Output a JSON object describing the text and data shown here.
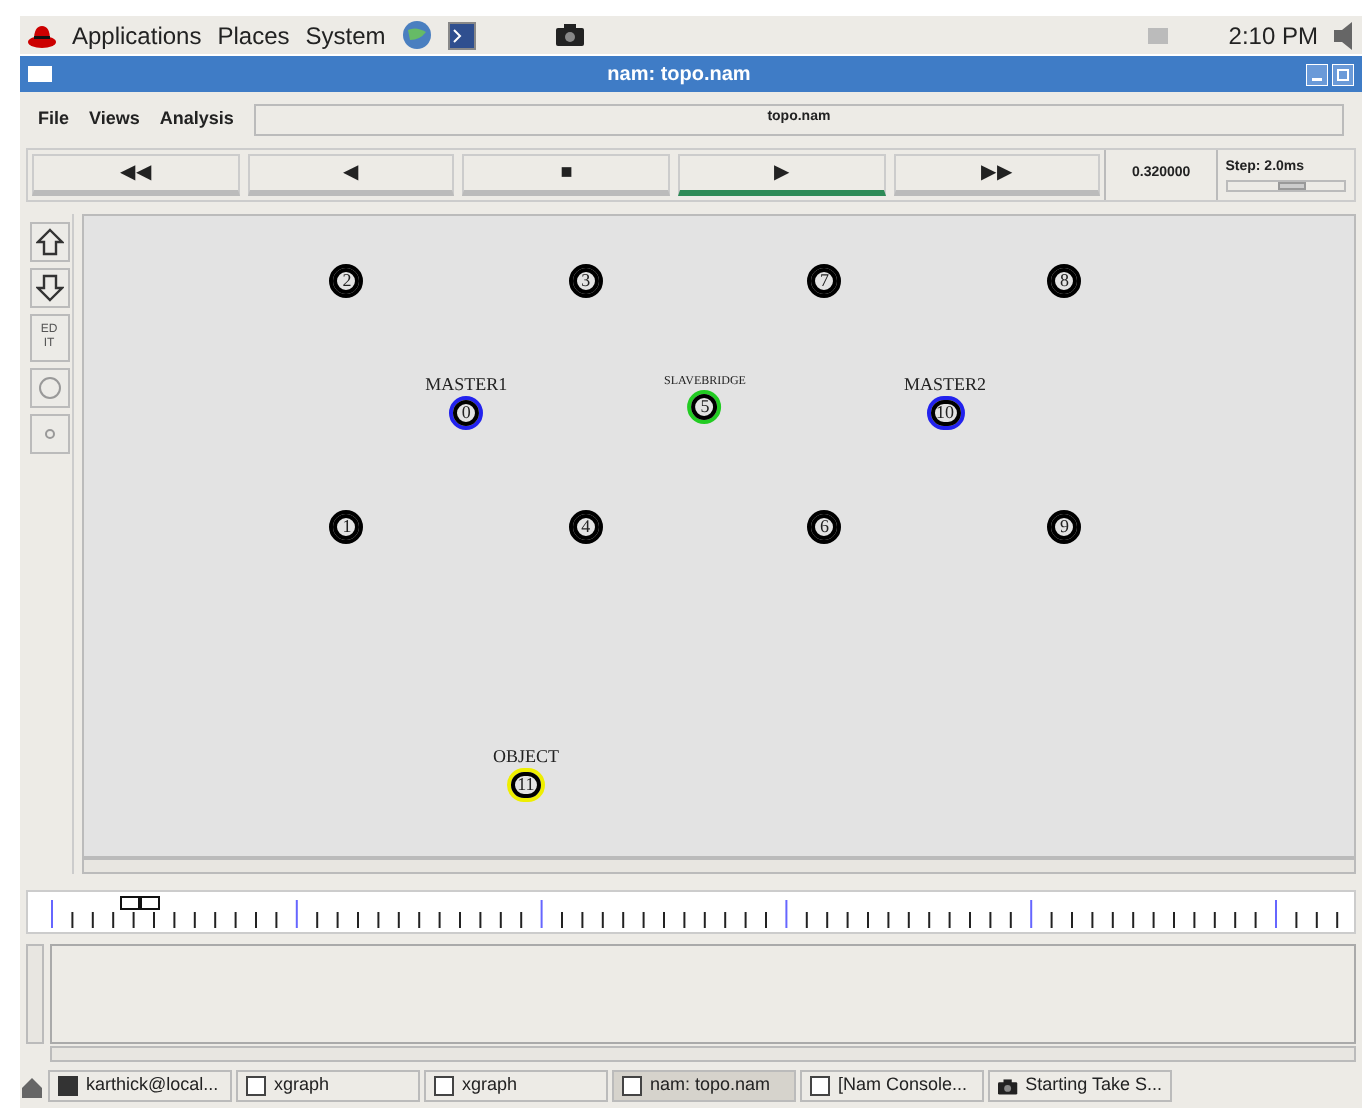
{
  "top_panel": {
    "menus": [
      "Applications",
      "Places",
      "System"
    ],
    "clock": "2:10 PM"
  },
  "window": {
    "title": "nam: topo.nam"
  },
  "menu_bar": {
    "items": [
      "File",
      "Views",
      "Analysis"
    ],
    "file_name": "topo.nam"
  },
  "transport": {
    "buttons": [
      {
        "label": "◀◀",
        "selected": false
      },
      {
        "label": "◀",
        "selected": false
      },
      {
        "label": "■",
        "selected": false
      },
      {
        "label": "▶",
        "selected": true
      },
      {
        "label": "▶▶",
        "selected": false
      }
    ],
    "time": "0.320000",
    "step": {
      "label": "Step: 2.0ms",
      "level": 0.6
    }
  },
  "tools": [
    {
      "kind": "zoom-in"
    },
    {
      "kind": "zoom-out"
    },
    {
      "kind": "text",
      "label": "EDIT"
    },
    {
      "kind": "circle"
    },
    {
      "kind": "dot"
    }
  ],
  "nodes": [
    {
      "id": "2",
      "color": "#000000"
    },
    {
      "id": "3",
      "color": "#000000"
    },
    {
      "id": "7",
      "color": "#000000"
    },
    {
      "id": "8",
      "color": "#000000"
    },
    {
      "id": "0",
      "label": "MASTER1",
      "color": "#2222ee"
    },
    {
      "id": "5",
      "label": "SLAVEBRIDGE",
      "color": "#22cc22"
    },
    {
      "id": "10",
      "label": "MASTER2",
      "color": "#2222ee"
    },
    {
      "id": "1",
      "color": "#000000"
    },
    {
      "id": "4",
      "color": "#000000"
    },
    {
      "id": "6",
      "color": "#000000"
    },
    {
      "id": "9",
      "color": "#000000"
    },
    {
      "id": "11",
      "label": "OBJECT",
      "color": "#eeee00"
    }
  ],
  "taskbar": [
    {
      "label": "karthick@local...",
      "kind": "terminal",
      "selected": false
    },
    {
      "label": "xgraph",
      "kind": "window",
      "selected": false
    },
    {
      "label": "xgraph",
      "kind": "window",
      "selected": false
    },
    {
      "label": "nam: topo.nam",
      "kind": "window",
      "selected": true
    },
    {
      "label": "[Nam Console...",
      "kind": "window",
      "selected": false
    },
    {
      "label": "Starting Take S...",
      "kind": "camera",
      "selected": false
    }
  ]
}
